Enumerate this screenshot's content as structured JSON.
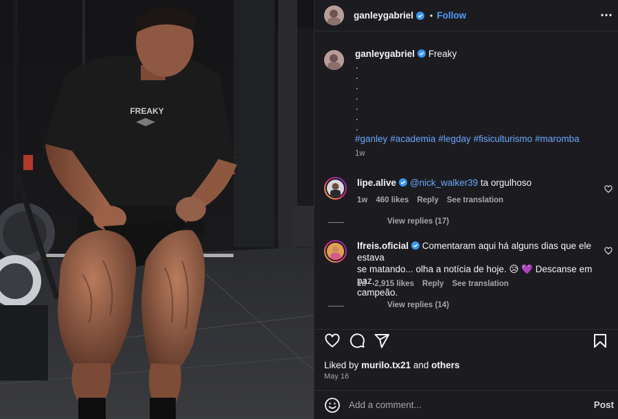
{
  "post": {
    "username": "ganleygabriel",
    "follow_label": "Follow",
    "separator": "•"
  },
  "caption": {
    "username": "ganleygabriel",
    "text": "Freaky",
    "dots": [
      ".",
      ".",
      ".",
      ".",
      ".",
      ".",
      "."
    ],
    "hashtags": [
      "#ganley",
      "#academia",
      "#legday",
      "#fisiculturismo",
      "#maromba"
    ],
    "time": "1w"
  },
  "comments": [
    {
      "username": "lipe.alive",
      "mention": "@nick_walker39",
      "text": "ta orgulhoso",
      "time": "1w",
      "likes": "460 likes",
      "reply_label": "Reply",
      "translate_label": "See translation",
      "view_replies": "View replies (17)"
    },
    {
      "username": "lfreis.oficial",
      "text_line1": "Comentaram aqui há alguns dias que ele estava",
      "text_line2": "se matando... olha a notícia de hoje. 😥 💜  Descanse em paz,",
      "text_line3": "campeão.",
      "time": "1d",
      "likes": "2,915 likes",
      "reply_label": "Reply",
      "translate_label": "See translation",
      "view_replies": "View replies (14)"
    }
  ],
  "actions": {
    "icons": [
      "heart-icon",
      "comment-icon",
      "share-icon",
      "bookmark-icon"
    ],
    "liked_by_prefix": "Liked by",
    "liked_by_user": "murilo.tx21",
    "liked_by_and": "and",
    "liked_by_others": "others",
    "date": "May 16"
  },
  "add_comment": {
    "placeholder": "Add a comment...",
    "post_label": "Post"
  },
  "photo": {
    "shirt_text": "FREAKY"
  },
  "colors": {
    "panel_bg": "#1c1c20",
    "link_blue": "#4c9fff",
    "hashtag_blue": "#6aa6ff",
    "verified_blue": "#3797f0",
    "muted": "#a8a8a8"
  }
}
